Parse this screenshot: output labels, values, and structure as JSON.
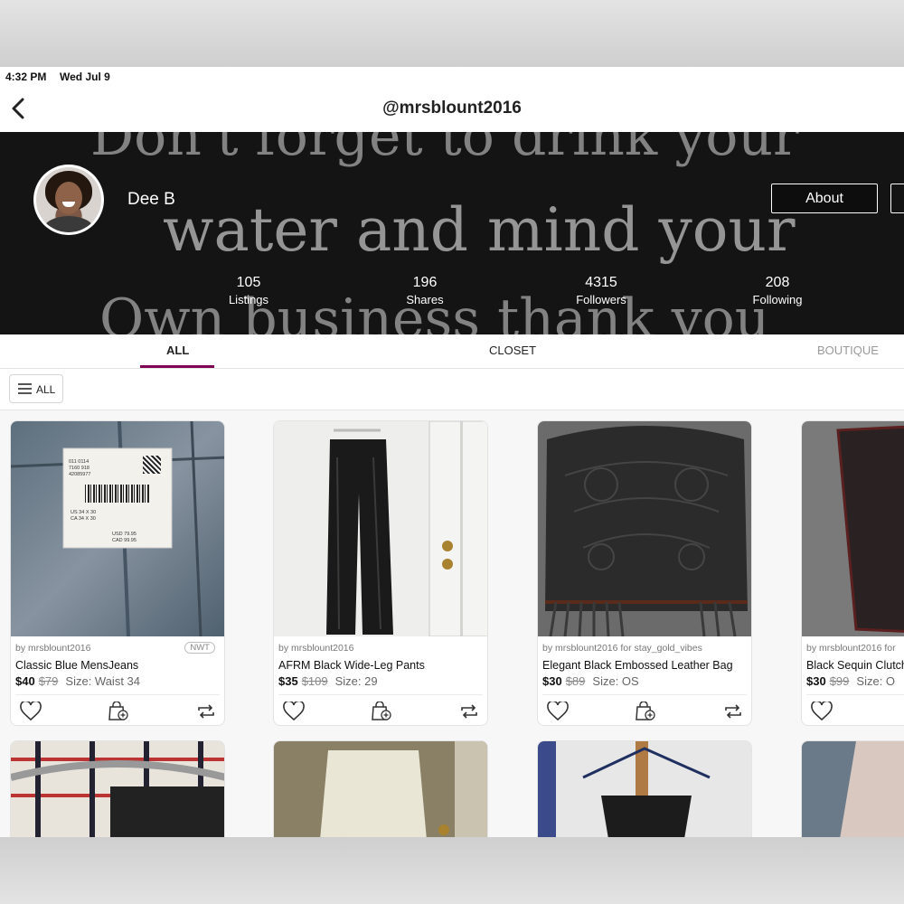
{
  "status": {
    "time": "4:32 PM",
    "date": "Wed Jul 9"
  },
  "nav": {
    "title": "@mrsblount2016"
  },
  "banner": {
    "line1": "Don't forget to drink your",
    "line2": "water and mind your",
    "line3": "Own business thank you"
  },
  "profile": {
    "name": "Dee B",
    "about_label": "About",
    "stats": [
      {
        "value": "105",
        "label": "Listings"
      },
      {
        "value": "196",
        "label": "Shares"
      },
      {
        "value": "4315",
        "label": "Followers"
      },
      {
        "value": "208",
        "label": "Following"
      }
    ]
  },
  "tabs": [
    {
      "label": "ALL",
      "active": true
    },
    {
      "label": "CLOSET",
      "active": false
    },
    {
      "label": "BOUTIQUE",
      "active": false
    }
  ],
  "filter": {
    "label": "ALL"
  },
  "tag_text": {
    "line1": "011 0114",
    "line2": "7160 918",
    "line3": "42085977",
    "sizes": "US 34 X 30",
    "sizes2": "CA 34 X 30",
    "price_usd": "USD 79.95",
    "price_cad": "CAD 99.95"
  },
  "listings": [
    {
      "by": "by mrsblount2016",
      "badge": "NWT",
      "title": "Classic Blue MensJeans",
      "price": "$40",
      "original": "$79",
      "size": "Size: Waist 34"
    },
    {
      "by": "by mrsblount2016",
      "badge": "",
      "title": "AFRM Black Wide-Leg Pants",
      "price": "$35",
      "original": "$109",
      "size": "Size: 29"
    },
    {
      "by": "by mrsblount2016 for stay_gold_vibes",
      "badge": "",
      "title": "Elegant Black Embossed Leather Bag",
      "price": "$30",
      "original": "$89",
      "size": "Size: OS"
    },
    {
      "by": "by mrsblount2016 for",
      "badge": "",
      "title": "Black Sequin Clutch",
      "price": "$30",
      "original": "$99",
      "size": "Size: O"
    }
  ],
  "icons": {
    "like": "heart-icon",
    "bundle": "bag-plus-icon",
    "share": "share-icon",
    "back": "chevron-left-icon",
    "menu": "menu-icon"
  },
  "colors": {
    "accent": "#7f0353",
    "banner_bg": "#1c1c1c"
  }
}
